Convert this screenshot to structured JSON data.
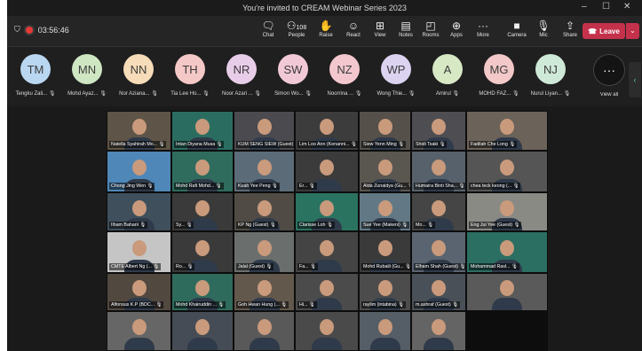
{
  "window": {
    "title": "You're invited to CREAM Webinar Series 2023",
    "min": "–",
    "max": "☐",
    "close": "✕"
  },
  "meeting": {
    "timer": "03:56:46"
  },
  "toolbar": {
    "chat": "Chat",
    "people": "People",
    "people_count": "108",
    "raise": "Raise",
    "react": "React",
    "view": "View",
    "notes": "Notes",
    "rooms": "Rooms",
    "apps": "Apps",
    "more": "More",
    "camera": "Camera",
    "mic": "Mic",
    "share": "Share",
    "leave": "Leave"
  },
  "participants_strip": [
    {
      "initials": "TM",
      "name": "Tengku Zali...",
      "color": "#b9d7f1"
    },
    {
      "initials": "MN",
      "name": "Mohd Ayaz...",
      "color": "#cfe6c3"
    },
    {
      "initials": "NN",
      "name": "Nor Aziana...",
      "color": "#f6dcb8"
    },
    {
      "initials": "TH",
      "name": "Tia Lee Ho...",
      "color": "#f5c8c8"
    },
    {
      "initials": "NR",
      "name": "Noor Azari ...",
      "color": "#e8cde8"
    },
    {
      "initials": "SW",
      "name": "Simon Wo...",
      "color": "#f1c9d6"
    },
    {
      "initials": "NZ",
      "name": "Noorrina ...",
      "color": "#f4c7cf"
    },
    {
      "initials": "WP",
      "name": "Wong Thie...",
      "color": "#dcd3f1"
    },
    {
      "initials": "A",
      "name": "Amirul",
      "color": "#d7e8c5"
    },
    {
      "initials": "MG",
      "name": "MOHD FAZ...",
      "color": "#f3c8c8"
    },
    {
      "initials": "NJ",
      "name": "Nurul Liyan...",
      "color": "#cfe9d8"
    }
  ],
  "view_all": {
    "label": "View all",
    "icon": "···"
  },
  "video_grid": [
    {
      "name": "Natella Syahirah Mo..."
    },
    {
      "name": "Intan Diyana Musa"
    },
    {
      "name": "KUM SENG SIEW (Guest)"
    },
    {
      "name": "Lim Loo Ann (Kenanni..."
    },
    {
      "name": "Siew Yenn Ming"
    },
    {
      "name": "Shidi Tsaki"
    },
    {
      "name": "Fadilah Che Long"
    },
    {
      "name": "Chong Jing Wen"
    },
    {
      "name": "Mohd Rafi Mohd..."
    },
    {
      "name": "Kuah Yee Peng"
    },
    {
      "name": "Er..."
    },
    {
      "name": "Alda Zunaidya (Gu..."
    },
    {
      "name": "Humaira Binti Sha..."
    },
    {
      "name": "chea teck keong (..."
    },
    {
      "name": "Ilham Baharii"
    },
    {
      "name": "Sy..."
    },
    {
      "name": "KP Ng (Guest)"
    },
    {
      "name": "Clarisse Loh"
    },
    {
      "name": "Sue Yee (Makeni)"
    },
    {
      "name": "Mo..."
    },
    {
      "name": "Eng Jui Yee (Guest)"
    },
    {
      "name": "CMTE Albert Ng (..."
    },
    {
      "name": "Ro..."
    },
    {
      "name": "Jalal (Guest)"
    },
    {
      "name": "Fa..."
    },
    {
      "name": "Mohd Rubaili (Gu..."
    },
    {
      "name": "Elham Shah (Guest)"
    },
    {
      "name": "Mohammad Rasl..."
    },
    {
      "name": "Alfonsus K.P (BDC..."
    },
    {
      "name": "Mohd Khairuddin ..."
    },
    {
      "name": "Goh Hwan Hung (..."
    },
    {
      "name": "Hi..."
    },
    {
      "name": "raylim (intabina)"
    },
    {
      "name": "m.ashraf (Guest)"
    },
    {
      "name": ""
    },
    {
      "name": ""
    },
    {
      "name": ""
    },
    {
      "name": ""
    },
    {
      "name": ""
    },
    {
      "name": ""
    },
    {
      "name": ""
    }
  ]
}
